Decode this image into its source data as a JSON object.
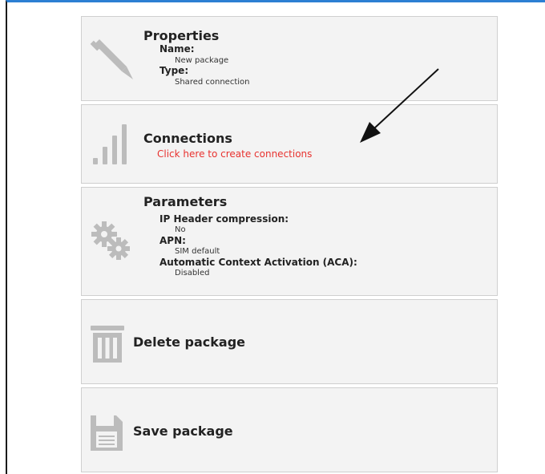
{
  "properties": {
    "title": "Properties",
    "name_label": "Name:",
    "name_value": "New package",
    "type_label": "Type:",
    "type_value": "Shared connection"
  },
  "connections": {
    "title": "Connections",
    "link": "Click here to create connections"
  },
  "parameters": {
    "title": "Parameters",
    "ip_header_label": "IP Header compression:",
    "ip_header_value": "No",
    "apn_label": "APN:",
    "apn_value": "SIM default",
    "aca_label": "Automatic Context Activation (ACA):",
    "aca_value": "Disabled"
  },
  "delete": {
    "label": "Delete package"
  },
  "save": {
    "label": "Save package"
  },
  "icons": {
    "properties": "pen-icon",
    "connections": "signal-bars-icon",
    "parameters": "gears-icon",
    "delete": "trash-icon",
    "save": "floppy-disk-icon",
    "annotation": "arrow-icon"
  },
  "colors": {
    "accent_top": "#2c7fd3",
    "link": "#e8322f",
    "card_bg": "#f3f3f3",
    "icon_gray": "#bcbcbc"
  }
}
